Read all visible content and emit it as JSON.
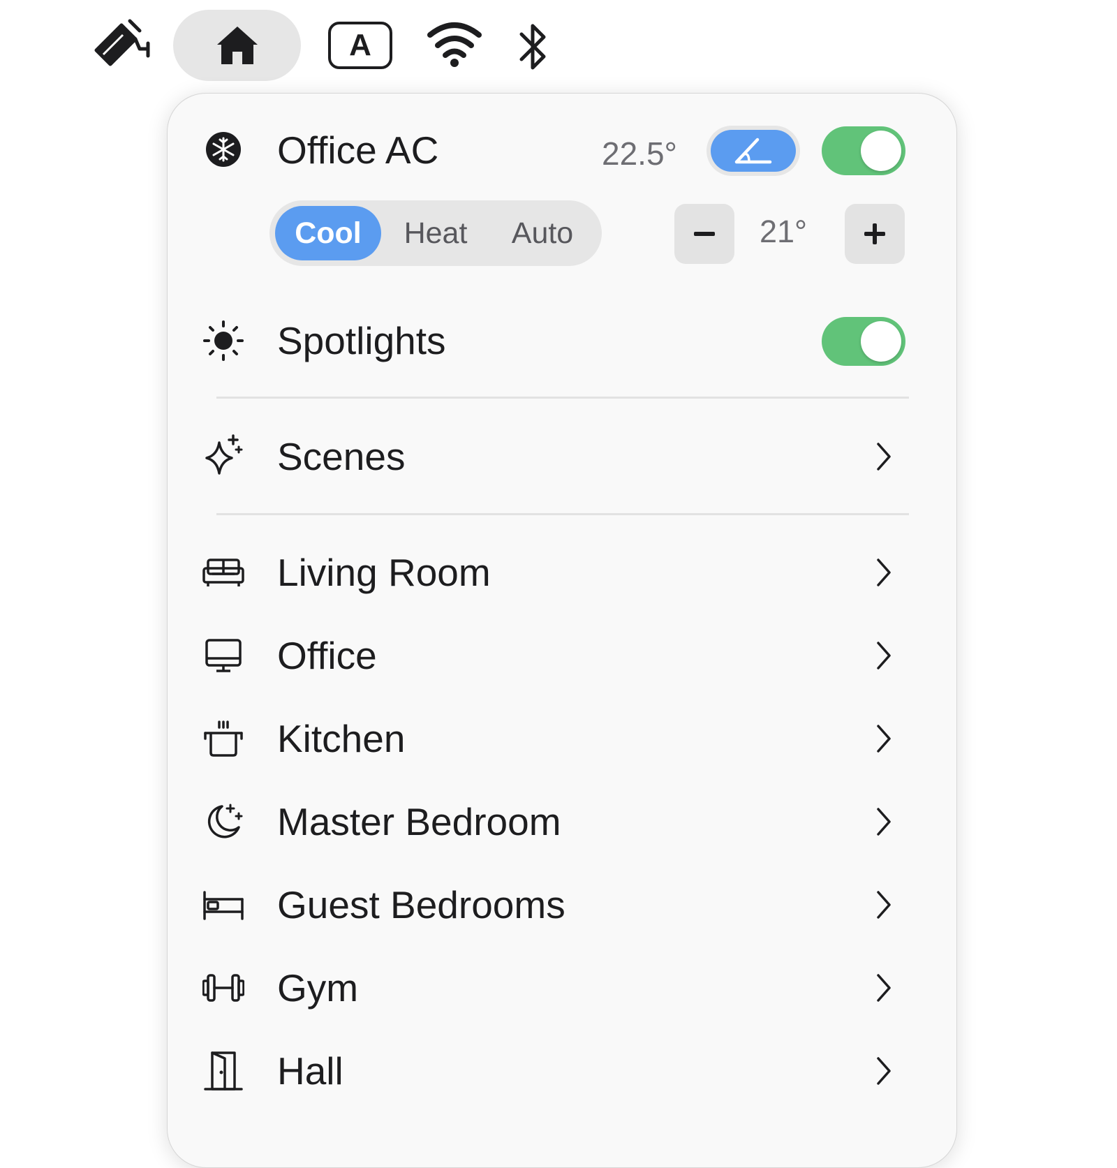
{
  "menubar": {
    "items": [
      {
        "icon": "security-camera-icon"
      },
      {
        "icon": "home-icon",
        "active": true
      },
      {
        "icon": "keyboard-input-icon",
        "label": "A"
      },
      {
        "icon": "wifi-icon"
      },
      {
        "icon": "bluetooth-icon"
      }
    ]
  },
  "panel": {
    "ac": {
      "icon": "snowflake-icon",
      "name": "Office AC",
      "current_temp": "22.5°",
      "swing_icon": "swing-angle-icon",
      "power_on": true,
      "modes": [
        "Cool",
        "Heat",
        "Auto"
      ],
      "active_mode": "Cool",
      "target_temp": "21°",
      "decrement_label": "–",
      "increment_label": "+"
    },
    "spotlights": {
      "icon": "sun-icon",
      "name": "Spotlights",
      "on": true
    },
    "scenes": {
      "icon": "sparkles-icon",
      "label": "Scenes"
    },
    "rooms": [
      {
        "icon": "sofa-icon",
        "label": "Living Room"
      },
      {
        "icon": "desktop-computer-icon",
        "label": "Office"
      },
      {
        "icon": "cooking-pot-icon",
        "label": "Kitchen"
      },
      {
        "icon": "moon-stars-icon",
        "label": "Master Bedroom"
      },
      {
        "icon": "bed-icon",
        "label": "Guest Bedrooms"
      },
      {
        "icon": "dumbbell-icon",
        "label": "Gym"
      },
      {
        "icon": "door-icon",
        "label": "Hall"
      }
    ]
  },
  "colors": {
    "accent_blue": "#5b9cf0",
    "toggle_green": "#61c379",
    "panel_bg": "#f9f9f9",
    "text_primary": "#1d1d1f",
    "text_secondary": "#6e6e73"
  }
}
